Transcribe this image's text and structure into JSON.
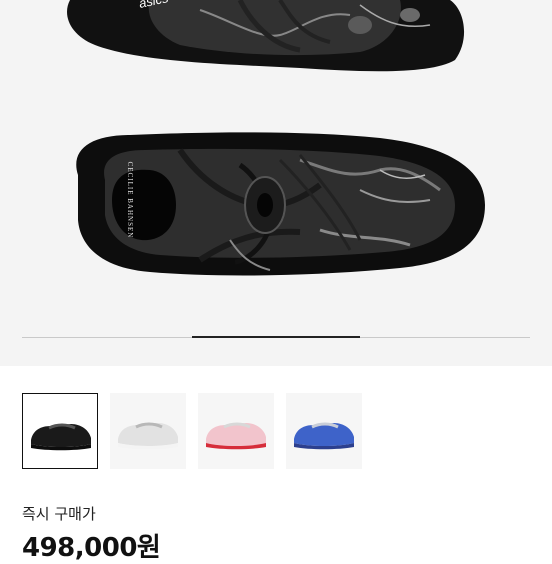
{
  "gallery": {
    "shoe_brand_text": "asics",
    "collar_text": "CECILIE BAHNSEN"
  },
  "thumbnails": [
    {
      "colorway": "black",
      "selected": true,
      "base": "#1a1a1a",
      "accent": "#555555",
      "sole": "#0d0d0d"
    },
    {
      "colorway": "silver",
      "selected": false,
      "base": "#e2e2e2",
      "accent": "#b8b8b8",
      "sole": "#f4f4f4"
    },
    {
      "colorway": "pink-red",
      "selected": false,
      "base": "#f2c4cc",
      "accent": "#d8d8d8",
      "sole": "#d62d3a"
    },
    {
      "colorway": "blue-silver",
      "selected": false,
      "base": "#3e63c9",
      "accent": "#c9ced8",
      "sole": "#2c3f8e"
    }
  ],
  "purchase": {
    "label": "즉시 구매가",
    "price": "498,000원"
  }
}
